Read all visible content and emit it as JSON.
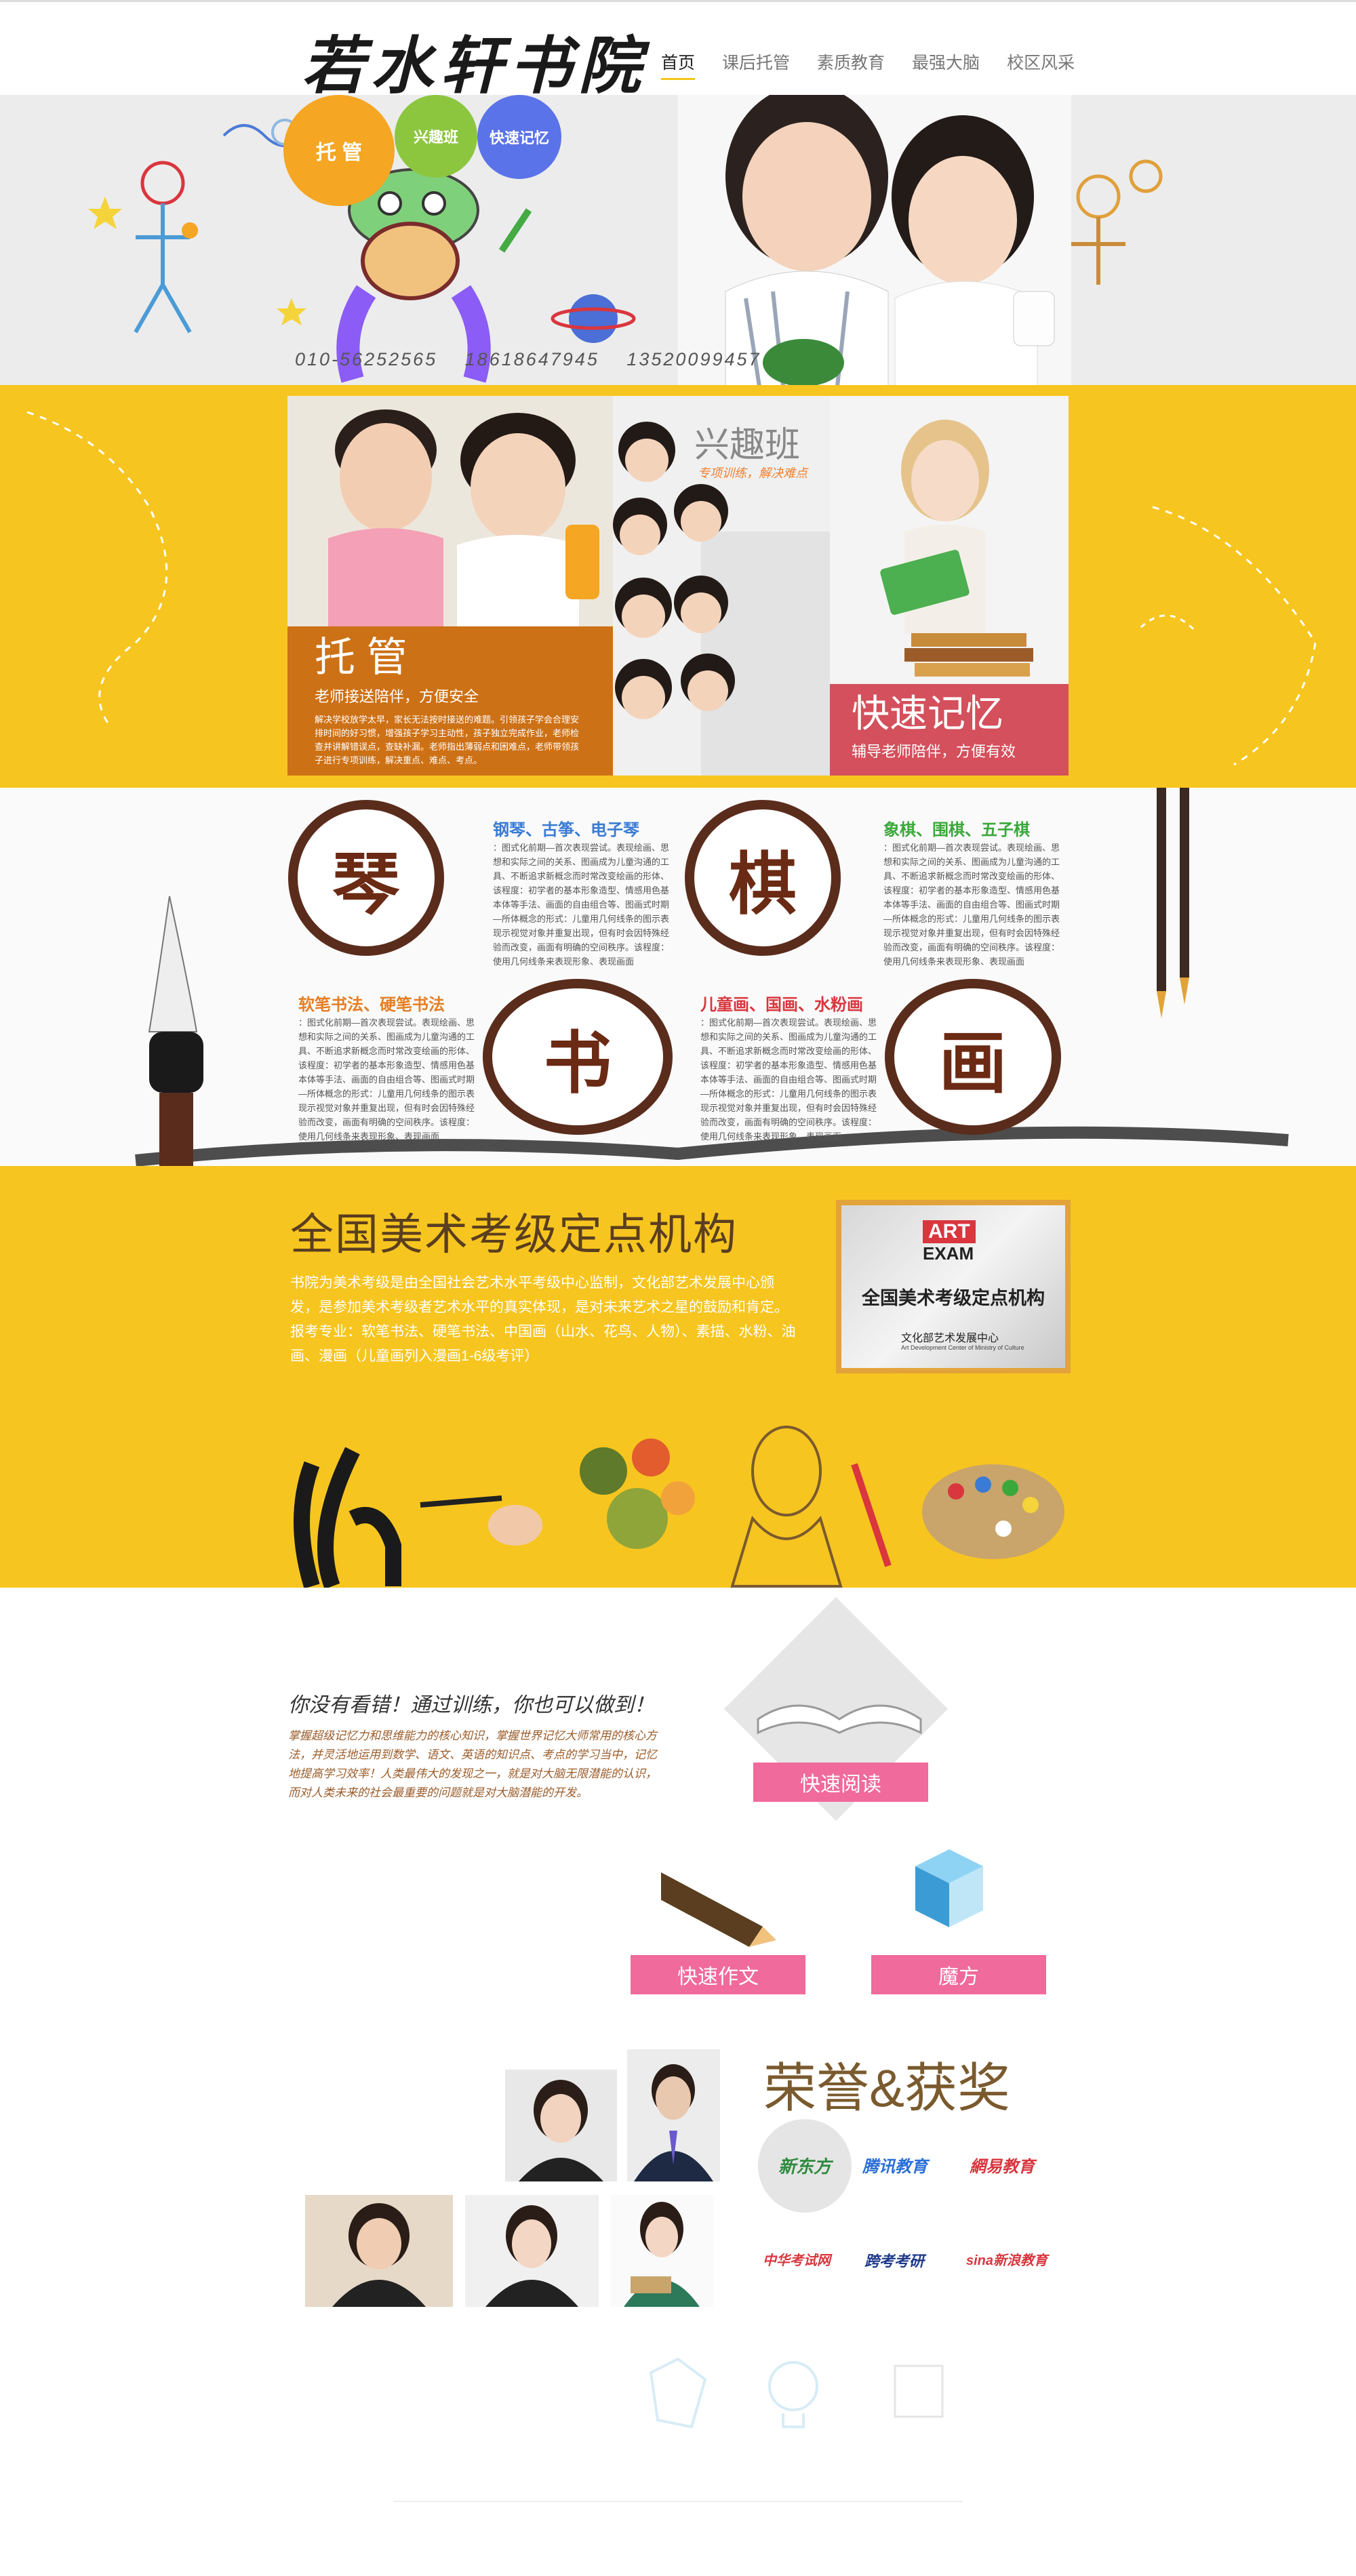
{
  "header": {
    "logo": "若水轩书院",
    "nav": [
      {
        "label": "首页",
        "active": true
      },
      {
        "label": "课后托管"
      },
      {
        "label": "素质教育"
      },
      {
        "label": "最强大脑"
      },
      {
        "label": "校区风采"
      }
    ]
  },
  "hero": {
    "bubbles": [
      "托 管",
      "兴趣班",
      "快速记忆"
    ],
    "phones": "010-56252565  18618647945  13520099457"
  },
  "services": {
    "tuoguan": {
      "title": "托 管",
      "subtitle": "老师接送陪伴，方便安全",
      "desc": "解决学校放学太早，家长无法按时接送的难题。引领孩子学会合理安排时间的好习惯，增强孩子学习主动性，孩子独立完成作业，老师检查并讲解错误点，查缺补漏。老师指出薄弱点和困难点，老师带领孩子进行专项训练，解决重点、难点、考点。"
    },
    "xingqu": {
      "title": "兴趣班",
      "subtitle": "专项训练，解决难点"
    },
    "kuaisu": {
      "title": "快速记忆",
      "subtitle": "辅导老师陪伴，方便有效"
    }
  },
  "arts": {
    "items": [
      {
        "icon_char": "琴",
        "title": "钢琴、古筝、电子琴",
        "color": "#3a7bd5"
      },
      {
        "icon_char": "棋",
        "title": "象棋、围棋、五子棋",
        "color": "#3aa83a"
      },
      {
        "icon_char": "书",
        "title": "软笔书法、硬笔书法",
        "color": "#e67e22"
      },
      {
        "icon_char": "画",
        "title": "儿童画、国画、水粉画",
        "color": "#d9363e"
      }
    ],
    "body_text": "：图式化前期—首次表现尝试。表现绘画、思想和实际之间的关系、图画成为儿童沟通的工具、不断追求新概念而时常改变绘画的形体、该程度：初学者的基本形象造型、情感用色基本体等手法、画面的自由组合等、图画式时期—所体概念的形式：儿童用几何线条的图示表现示视觉对象并重复出现，但有时会因特殊经验而改变，画面有明确的空间秩序。该程度：使用几何线条来表现形象、表现画面"
  },
  "exam": {
    "title": "全国美术考级定点机构",
    "description": "书院为美术考级是由全国社会艺术水平考级中心监制，文化部艺术发展中心颁发，是参加美术考级者艺术水平的真实体现，是对未来艺术之星的鼓励和肯定。报考专业：软笔书法、硬笔书法、中国画（山水、花鸟、人物）、素描、水粉、油画、漫画（儿童画列入漫画1-6级考评）",
    "cert_logo_top": "ART",
    "cert_logo_bottom": "EXAM",
    "cert_title": "全国美术考级定点机构",
    "cert_org": "文化部艺术发展中心",
    "cert_org_en": "Art Development Center of Ministry of Culture"
  },
  "programs": {
    "slogan": "你没有看错！通过训练，你也可以做到！",
    "text": "掌握超级记忆力和思维能力的核心知识，掌握世界记忆大师常用的核心方法，并灵活地运用到数学、语文、英语的知识点、考点的学习当中，记忆地提高学习效率！人类最伟大的发现之一，就是对大脑无限潜能的认识，而对人类未来的社会最重要的问题就是对大脑潜能的开发。",
    "labels": [
      "快速阅读",
      "快速作文",
      "魔方"
    ]
  },
  "honors": {
    "title": "荣誉&获奖",
    "partners": [
      "新东方",
      "腾讯教育",
      "網易教育",
      "中华考试网",
      "跨考考研",
      "sina新浪教育"
    ]
  }
}
